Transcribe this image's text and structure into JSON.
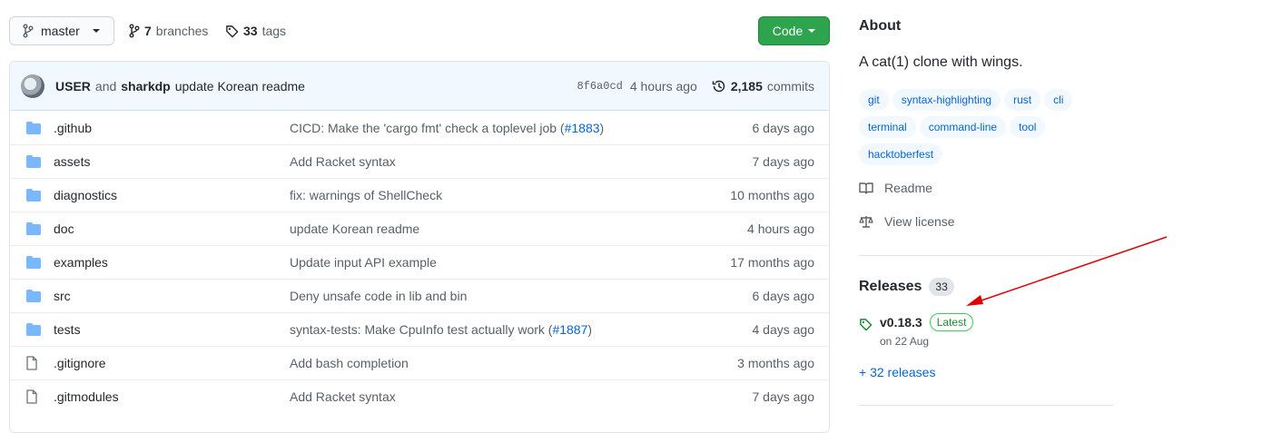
{
  "toolbar": {
    "branch": "master",
    "branches_count": "7",
    "branches_label": "branches",
    "tags_count": "33",
    "tags_label": "tags",
    "code_label": "Code"
  },
  "latest_commit": {
    "author": "USER",
    "and_label": "and",
    "coauthor": "sharkdp",
    "message": "update Korean readme",
    "sha": "8f6a0cd",
    "time": "4 hours ago",
    "commits_count": "2,185",
    "commits_label": "commits"
  },
  "files": [
    {
      "type": "folder",
      "name": ".github",
      "message": "CICD: Make the 'cargo fmt' check a toplevel job (",
      "pr": "#1883",
      "message_end": ")",
      "age": "6 days ago"
    },
    {
      "type": "folder",
      "name": "assets",
      "message": "Add Racket syntax",
      "pr": "",
      "message_end": "",
      "age": "7 days ago"
    },
    {
      "type": "folder",
      "name": "diagnostics",
      "message": "fix: warnings of ShellCheck",
      "pr": "",
      "message_end": "",
      "age": "10 months ago"
    },
    {
      "type": "folder",
      "name": "doc",
      "message": "update Korean readme",
      "pr": "",
      "message_end": "",
      "age": "4 hours ago"
    },
    {
      "type": "folder",
      "name": "examples",
      "message": "Update input API example",
      "pr": "",
      "message_end": "",
      "age": "17 months ago"
    },
    {
      "type": "folder",
      "name": "src",
      "message": "Deny unsafe code in lib and bin",
      "pr": "",
      "message_end": "",
      "age": "6 days ago"
    },
    {
      "type": "folder",
      "name": "tests",
      "message": "syntax-tests: Make CpuInfo test actually work (",
      "pr": "#1887",
      "message_end": ")",
      "age": "4 days ago"
    },
    {
      "type": "file",
      "name": ".gitignore",
      "message": "Add bash completion",
      "pr": "",
      "message_end": "",
      "age": "3 months ago"
    },
    {
      "type": "file",
      "name": ".gitmodules",
      "message": "Add Racket syntax",
      "pr": "",
      "message_end": "",
      "age": "7 days ago"
    }
  ],
  "about": {
    "heading": "About",
    "description": "A cat(1) clone with wings.",
    "topics": [
      "git",
      "syntax-highlighting",
      "rust",
      "cli",
      "terminal",
      "command-line",
      "tool",
      "hacktoberfest"
    ],
    "readme_label": "Readme",
    "license_label": "View license"
  },
  "releases": {
    "heading": "Releases",
    "count": "33",
    "latest_version": "v0.18.3",
    "latest_badge": "Latest",
    "latest_date": "on 22 Aug",
    "more_label": "+ 32 releases"
  },
  "colors": {
    "accent_link": "#0366d6",
    "code_button": "#2ea44f",
    "folder_icon": "#79b8ff",
    "annotation_arrow": "#e00000"
  }
}
